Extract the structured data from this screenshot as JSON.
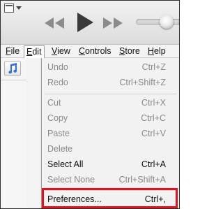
{
  "menubar": {
    "file": "File",
    "edit": "Edit",
    "view": "View",
    "controls": "Controls",
    "store": "Store",
    "help": "Help"
  },
  "edit_menu": {
    "items": [
      {
        "label": "Undo",
        "shortcut": "Ctrl+Z",
        "enabled": false
      },
      {
        "label": "Redo",
        "shortcut": "Ctrl+Shift+Z",
        "enabled": false
      },
      {
        "label": "Cut",
        "shortcut": "Ctrl+X",
        "enabled": false
      },
      {
        "label": "Copy",
        "shortcut": "Ctrl+C",
        "enabled": false
      },
      {
        "label": "Paste",
        "shortcut": "Ctrl+V",
        "enabled": false
      },
      {
        "label": "Delete",
        "shortcut": "",
        "enabled": false
      },
      {
        "label": "Select All",
        "shortcut": "Ctrl+A",
        "enabled": true
      },
      {
        "label": "Select None",
        "shortcut": "Ctrl+Shift+A",
        "enabled": false
      },
      {
        "label": "Preferences...",
        "shortcut": "Ctrl+,",
        "enabled": true,
        "highlighted": true
      }
    ]
  },
  "icons": {
    "window_menu": "window-menu-icon",
    "rewind": "rewind-icon",
    "play": "play-icon",
    "forward": "fast-forward-icon",
    "music": "music-note-icon"
  },
  "colors": {
    "highlight_border": "#e0141e",
    "disabled_text": "#8a8a8a",
    "music_icon": "#2f6fd6"
  }
}
